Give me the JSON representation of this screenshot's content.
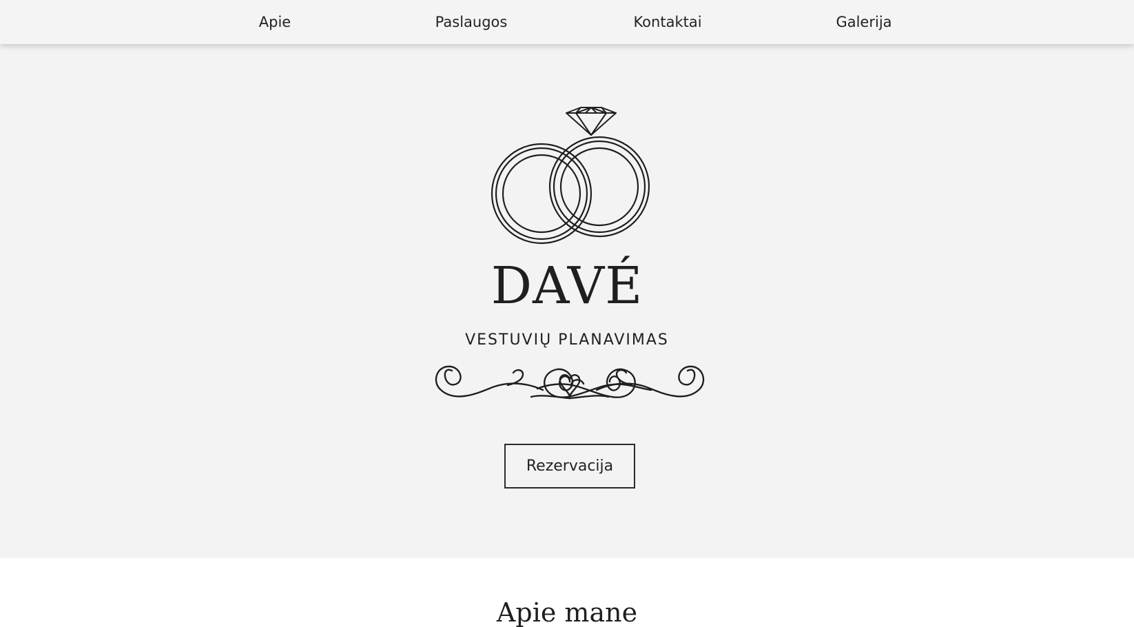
{
  "nav": {
    "items": [
      {
        "label": "Apie"
      },
      {
        "label": "Paslaugos"
      },
      {
        "label": "Kontaktai"
      },
      {
        "label": "Galerija"
      }
    ]
  },
  "hero": {
    "brand": "DAVÉ",
    "tagline": "VESTUVIŲ PLANAVIMAS",
    "logo_icon": "wedding-rings-with-diamond",
    "ornament_icon": "heart-swirl-divider",
    "reserve_label": "Rezervacija",
    "background_color": "#f3f3f3"
  },
  "about": {
    "title": "Apie mane"
  }
}
